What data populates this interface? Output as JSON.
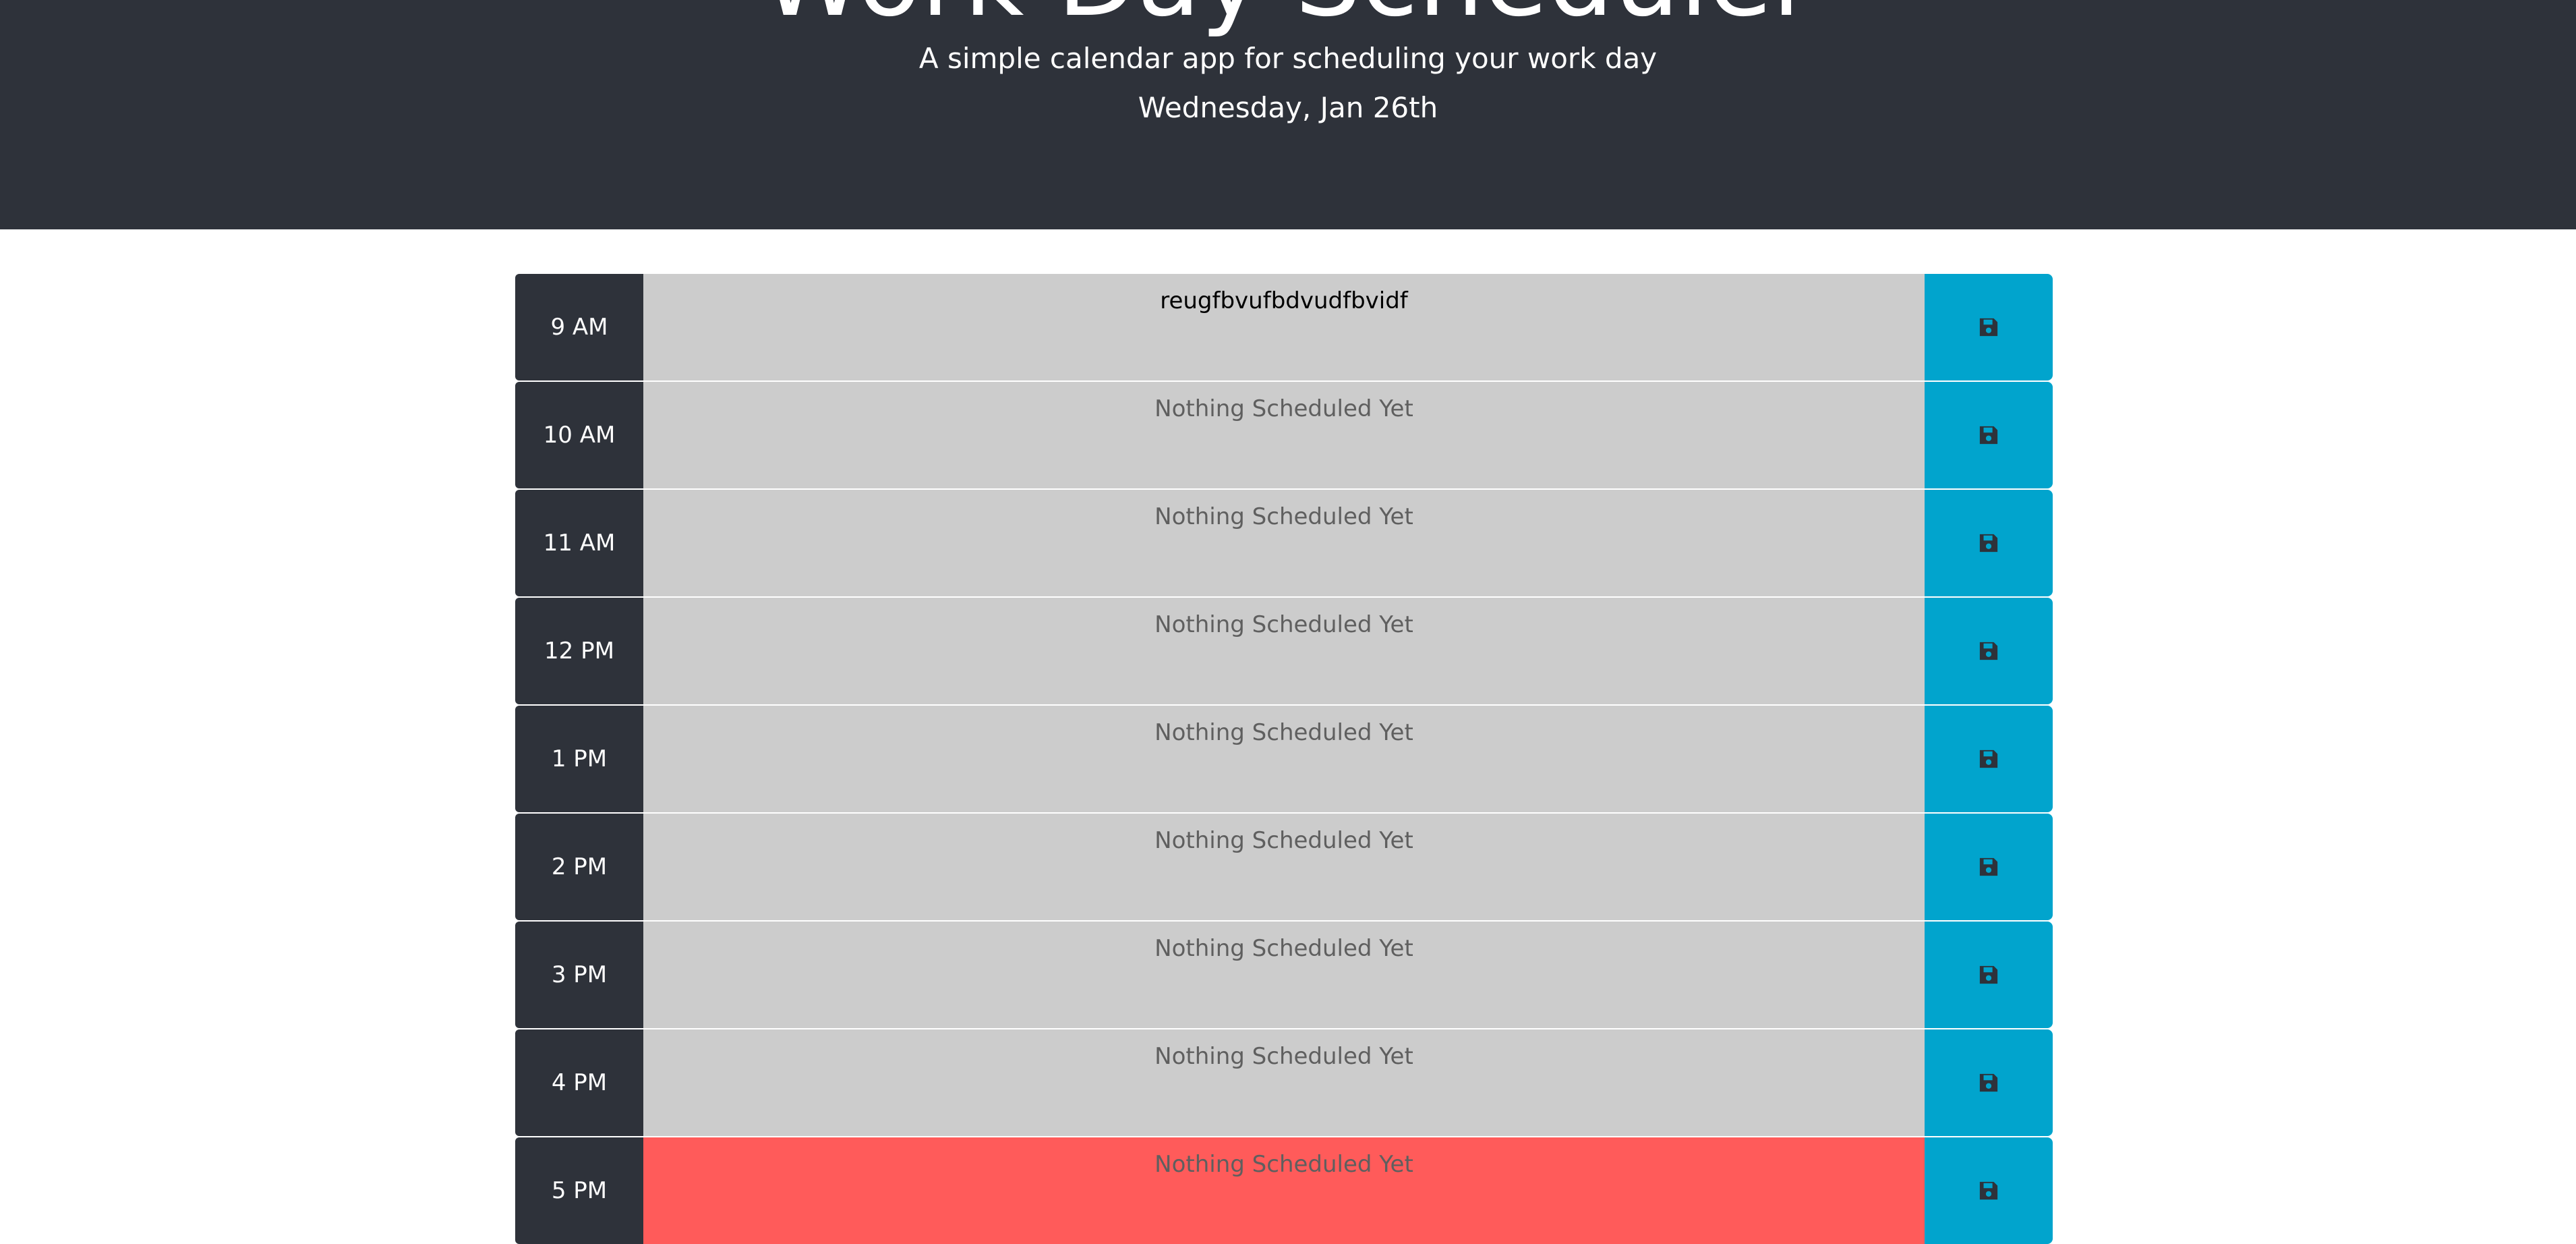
{
  "header": {
    "title": "Work Day Scheduler",
    "subtitle": "A simple calendar app for scheduling your work day",
    "date": "Wednesday, Jan 26th"
  },
  "colors": {
    "header_bg": "#2e323a",
    "past": "#cccccc",
    "present": "#ff5b5a",
    "save_button": "#01a4cd"
  },
  "save_icon": "floppy-disk-icon",
  "rows": [
    {
      "hour": "9 AM",
      "text": "reugfbvufbdvudfbvidf",
      "state": "past",
      "filled": true
    },
    {
      "hour": "10 AM",
      "text": "Nothing Scheduled Yet",
      "state": "past",
      "filled": false
    },
    {
      "hour": "11 AM",
      "text": "Nothing Scheduled Yet",
      "state": "past",
      "filled": false
    },
    {
      "hour": "12 PM",
      "text": "Nothing Scheduled Yet",
      "state": "past",
      "filled": false
    },
    {
      "hour": "1 PM",
      "text": "Nothing Scheduled Yet",
      "state": "past",
      "filled": false
    },
    {
      "hour": "2 PM",
      "text": "Nothing Scheduled Yet",
      "state": "past",
      "filled": false
    },
    {
      "hour": "3 PM",
      "text": "Nothing Scheduled Yet",
      "state": "past",
      "filled": false
    },
    {
      "hour": "4 PM",
      "text": "Nothing Scheduled Yet",
      "state": "past",
      "filled": false
    },
    {
      "hour": "5 PM",
      "text": "Nothing Scheduled Yet",
      "state": "present",
      "filled": false
    }
  ]
}
